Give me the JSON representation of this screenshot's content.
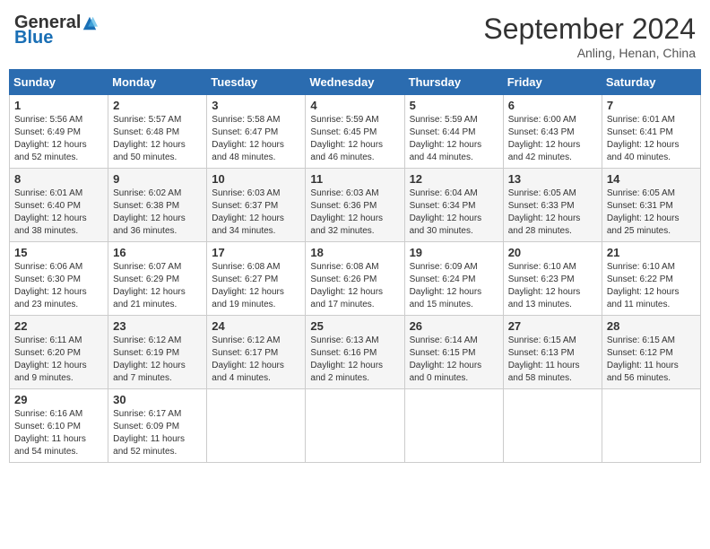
{
  "header": {
    "logo_general": "General",
    "logo_blue": "Blue",
    "month_title": "September 2024",
    "location": "Anling, Henan, China"
  },
  "weekdays": [
    "Sunday",
    "Monday",
    "Tuesday",
    "Wednesday",
    "Thursday",
    "Friday",
    "Saturday"
  ],
  "weeks": [
    [
      {
        "day": "1",
        "sunrise": "5:56 AM",
        "sunset": "6:49 PM",
        "daylight": "12 hours and 52 minutes."
      },
      {
        "day": "2",
        "sunrise": "5:57 AM",
        "sunset": "6:48 PM",
        "daylight": "12 hours and 50 minutes."
      },
      {
        "day": "3",
        "sunrise": "5:58 AM",
        "sunset": "6:47 PM",
        "daylight": "12 hours and 48 minutes."
      },
      {
        "day": "4",
        "sunrise": "5:59 AM",
        "sunset": "6:45 PM",
        "daylight": "12 hours and 46 minutes."
      },
      {
        "day": "5",
        "sunrise": "5:59 AM",
        "sunset": "6:44 PM",
        "daylight": "12 hours and 44 minutes."
      },
      {
        "day": "6",
        "sunrise": "6:00 AM",
        "sunset": "6:43 PM",
        "daylight": "12 hours and 42 minutes."
      },
      {
        "day": "7",
        "sunrise": "6:01 AM",
        "sunset": "6:41 PM",
        "daylight": "12 hours and 40 minutes."
      }
    ],
    [
      {
        "day": "8",
        "sunrise": "6:01 AM",
        "sunset": "6:40 PM",
        "daylight": "12 hours and 38 minutes."
      },
      {
        "day": "9",
        "sunrise": "6:02 AM",
        "sunset": "6:38 PM",
        "daylight": "12 hours and 36 minutes."
      },
      {
        "day": "10",
        "sunrise": "6:03 AM",
        "sunset": "6:37 PM",
        "daylight": "12 hours and 34 minutes."
      },
      {
        "day": "11",
        "sunrise": "6:03 AM",
        "sunset": "6:36 PM",
        "daylight": "12 hours and 32 minutes."
      },
      {
        "day": "12",
        "sunrise": "6:04 AM",
        "sunset": "6:34 PM",
        "daylight": "12 hours and 30 minutes."
      },
      {
        "day": "13",
        "sunrise": "6:05 AM",
        "sunset": "6:33 PM",
        "daylight": "12 hours and 28 minutes."
      },
      {
        "day": "14",
        "sunrise": "6:05 AM",
        "sunset": "6:31 PM",
        "daylight": "12 hours and 25 minutes."
      }
    ],
    [
      {
        "day": "15",
        "sunrise": "6:06 AM",
        "sunset": "6:30 PM",
        "daylight": "12 hours and 23 minutes."
      },
      {
        "day": "16",
        "sunrise": "6:07 AM",
        "sunset": "6:29 PM",
        "daylight": "12 hours and 21 minutes."
      },
      {
        "day": "17",
        "sunrise": "6:08 AM",
        "sunset": "6:27 PM",
        "daylight": "12 hours and 19 minutes."
      },
      {
        "day": "18",
        "sunrise": "6:08 AM",
        "sunset": "6:26 PM",
        "daylight": "12 hours and 17 minutes."
      },
      {
        "day": "19",
        "sunrise": "6:09 AM",
        "sunset": "6:24 PM",
        "daylight": "12 hours and 15 minutes."
      },
      {
        "day": "20",
        "sunrise": "6:10 AM",
        "sunset": "6:23 PM",
        "daylight": "12 hours and 13 minutes."
      },
      {
        "day": "21",
        "sunrise": "6:10 AM",
        "sunset": "6:22 PM",
        "daylight": "12 hours and 11 minutes."
      }
    ],
    [
      {
        "day": "22",
        "sunrise": "6:11 AM",
        "sunset": "6:20 PM",
        "daylight": "12 hours and 9 minutes."
      },
      {
        "day": "23",
        "sunrise": "6:12 AM",
        "sunset": "6:19 PM",
        "daylight": "12 hours and 7 minutes."
      },
      {
        "day": "24",
        "sunrise": "6:12 AM",
        "sunset": "6:17 PM",
        "daylight": "12 hours and 4 minutes."
      },
      {
        "day": "25",
        "sunrise": "6:13 AM",
        "sunset": "6:16 PM",
        "daylight": "12 hours and 2 minutes."
      },
      {
        "day": "26",
        "sunrise": "6:14 AM",
        "sunset": "6:15 PM",
        "daylight": "12 hours and 0 minutes."
      },
      {
        "day": "27",
        "sunrise": "6:15 AM",
        "sunset": "6:13 PM",
        "daylight": "11 hours and 58 minutes."
      },
      {
        "day": "28",
        "sunrise": "6:15 AM",
        "sunset": "6:12 PM",
        "daylight": "11 hours and 56 minutes."
      }
    ],
    [
      {
        "day": "29",
        "sunrise": "6:16 AM",
        "sunset": "6:10 PM",
        "daylight": "11 hours and 54 minutes."
      },
      {
        "day": "30",
        "sunrise": "6:17 AM",
        "sunset": "6:09 PM",
        "daylight": "11 hours and 52 minutes."
      },
      null,
      null,
      null,
      null,
      null
    ]
  ]
}
